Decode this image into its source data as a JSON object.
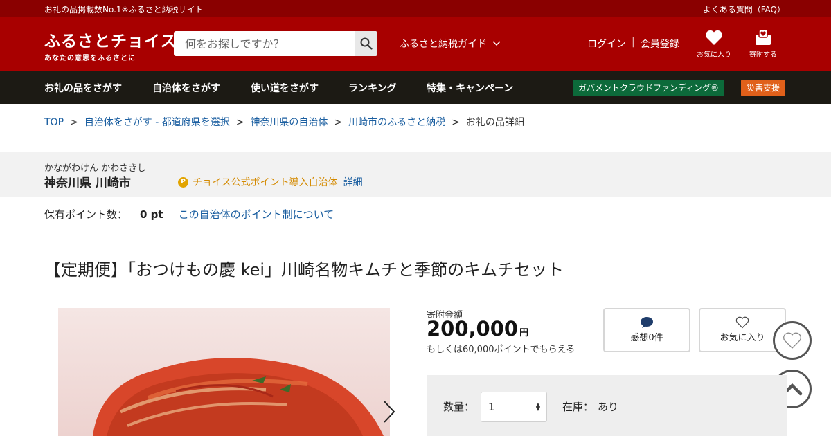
{
  "topstrip": {
    "tagline": "お礼の品掲載数No.1※ふるさと納税サイト",
    "faq": "よくある質問（FAQ）"
  },
  "header": {
    "logo_main": "ふるさとチョイス",
    "logo_sub": "あなたの意思をふるさとに",
    "search_placeholder": "何をお探しですか？",
    "guide": "ふるさと納税ガイド",
    "login": "ログイン",
    "register": "会員登録",
    "favorites": "お気に入り",
    "donate": "寄附する"
  },
  "nav": {
    "items": [
      "お礼の品をさがす",
      "自治体をさがす",
      "使い道をさがす",
      "ランキング",
      "特集・キャンペーン"
    ],
    "gov_funding": "ガバメントクラウドファンディング®",
    "disaster": "災害支援"
  },
  "breadcrumb": {
    "items": [
      "TOP",
      "自治体をさがす - 都道府県を選択",
      "神奈川県の自治体",
      "川崎市のふるさと納税"
    ],
    "current": "お礼の品詳細"
  },
  "municipality": {
    "kana": "かながわけん かわさきし",
    "name": "神奈川県 川崎市",
    "point_notice": "チョイス公式ポイント導入自治体",
    "detail": "詳細"
  },
  "points": {
    "label": "保有ポイント数：",
    "value": "0 pt",
    "link": "この自治体のポイント制について"
  },
  "product": {
    "title": "【定期便】「おつけもの慶 kei」川崎名物キムチと季節のキムチセット",
    "price_label": "寄附金額",
    "price": "200,000",
    "currency": "円",
    "points_alt": "もしくは60,000ポイントでもらえる",
    "reviews": "感想0件",
    "favorite": "お気に入り",
    "qty_label": "数量：",
    "qty_value": "1",
    "stock_label": "在庫：",
    "stock_value": "あり"
  },
  "colors": {
    "header": "#a80000",
    "nav": "#1c1a14",
    "link": "#1a5ea0",
    "gov": "#0c6a3a",
    "disaster": "#e0601a"
  }
}
